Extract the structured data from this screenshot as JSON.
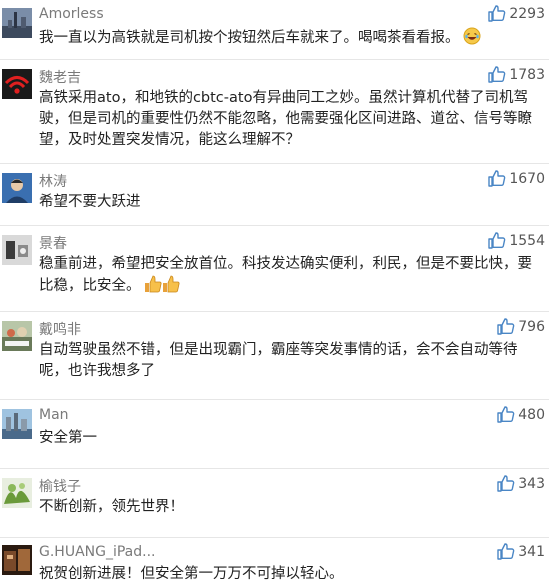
{
  "comments": [
    {
      "user": "Amorless",
      "likes": "2293",
      "text": "我一直以为高铁就是司机按个按钮然后车就来了。喝喝茶看看报。",
      "emoji": "laughing-emoji"
    },
    {
      "user": "魏老吉",
      "likes": "1783",
      "text": "高铁采用ato，和地铁的cbtc-ato有异曲同工之妙。虽然计算机代替了司机驾驶，但是司机的重要性仍然不能忽略，他需要强化区间进路、道岔、信号等瞭望，及时处置突发情况，能这么理解不？"
    },
    {
      "user": "林涛",
      "likes": "1670",
      "text": "希望不要大跃进"
    },
    {
      "user": "景春",
      "likes": "1554",
      "text": "稳重前进，希望把安全放首位。科技发达确实便利，利民，但是不要比快，要比稳，比安全。",
      "emoji": "thumbs-up-emoji"
    },
    {
      "user": "戴鸣非",
      "likes": "796",
      "text": "自动驾驶虽然不错，但是出现霸门，霸座等突发事情的话，会不会自动等待呢，也许我想多了"
    },
    {
      "user": "Man",
      "likes": "480",
      "text": "安全第一"
    },
    {
      "user": "榆钱子",
      "likes": "343",
      "text": "不断创新，领先世界！"
    },
    {
      "user": "G.HUANG_iPad...",
      "likes": "341",
      "text": "祝贺创新进展！但安全第一万万不可掉以轻心。"
    }
  ],
  "icons": {
    "like": "thumbs-up-icon"
  },
  "colors": {
    "like_icon": "#4a86c5",
    "username": "#7a7a7a",
    "text": "#222222"
  }
}
